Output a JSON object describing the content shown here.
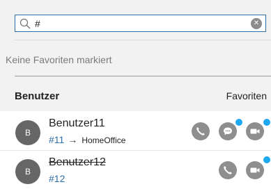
{
  "search": {
    "value": "#",
    "placeholder": ""
  },
  "favorites": {
    "empty_text": "Keine Favoriten markiert"
  },
  "list_header": {
    "users_label": "Benutzer",
    "favorites_label": "Favoriten"
  },
  "users": [
    {
      "name": "Benutzer11",
      "avatar": "B",
      "number": "#11",
      "arrow": "→",
      "status": "HomeOffice",
      "strikethrough": false
    },
    {
      "name": "Benutzer12",
      "avatar": "B",
      "number": "#12",
      "strikethrough": true
    }
  ],
  "colors": {
    "accent": "#2f6fa8",
    "badge": "#1da8f0",
    "action_gray": "#8e8e8e",
    "avatar_gray": "#666666"
  }
}
